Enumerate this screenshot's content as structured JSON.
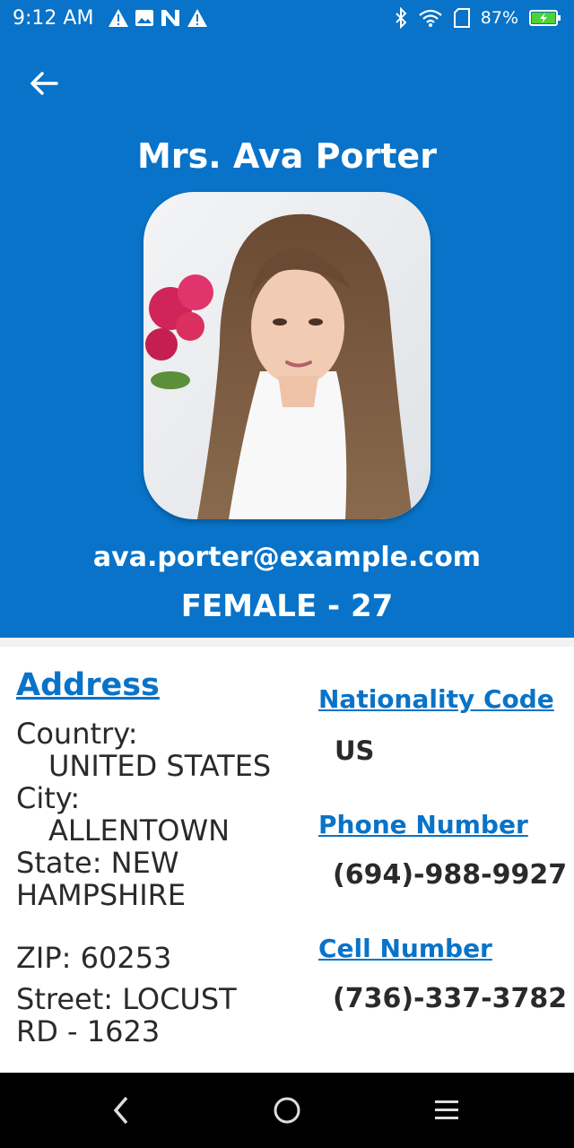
{
  "status_bar": {
    "time": "9:12 AM",
    "battery": "87%",
    "notification_icons": [
      "warning-icon",
      "image-icon",
      "n-app-icon",
      "warning-icon"
    ],
    "system_icons": [
      "bluetooth-icon",
      "wifi-icon",
      "sim-card-icon",
      "battery-charging-icon"
    ]
  },
  "header": {
    "name": "Mrs. Ava Porter",
    "email": "ava.porter@example.com",
    "gender_age": "FEMALE - 27"
  },
  "address": {
    "heading": "Address",
    "country_label": "Country:",
    "country_value": "UNITED STATES",
    "city_label": "City:",
    "city_value": "ALLENTOWN",
    "state_line1": "State: NEW",
    "state_line2": "HAMPSHIRE",
    "zip": "ZIP: 60253",
    "street_line1": "Street: LOCUST",
    "street_line2": "RD - 1623"
  },
  "nationality": {
    "heading": "Nationality Code",
    "value": "US"
  },
  "phone": {
    "heading": "Phone Number",
    "value": "(694)-988-9927"
  },
  "cell": {
    "heading": "Cell Number",
    "value": "(736)-337-3782"
  },
  "colors": {
    "accent": "#0873c8",
    "text": "#2a2a2a",
    "background": "#ffffff"
  }
}
